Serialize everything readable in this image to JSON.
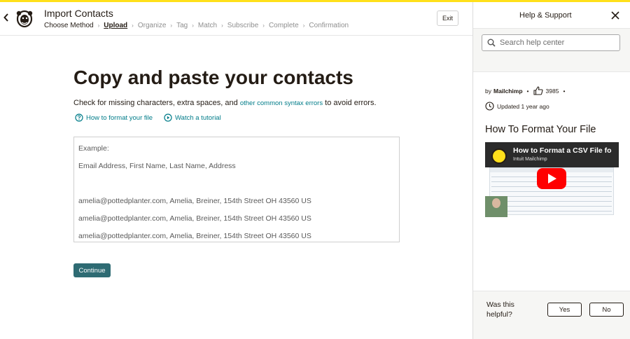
{
  "app": {
    "title": "Import Contacts",
    "exit_label": "Exit",
    "accent_color": "#ffe01b",
    "link_color": "#007c89",
    "button_color": "#2e6b73"
  },
  "steps": [
    {
      "label": "Choose Method",
      "state": "done"
    },
    {
      "label": "Upload",
      "state": "active"
    },
    {
      "label": "Organize",
      "state": "pending"
    },
    {
      "label": "Tag",
      "state": "pending"
    },
    {
      "label": "Match",
      "state": "pending"
    },
    {
      "label": "Subscribe",
      "state": "pending"
    },
    {
      "label": "Complete",
      "state": "pending"
    },
    {
      "label": "Confirmation",
      "state": "pending"
    }
  ],
  "main": {
    "heading": "Copy and paste your contacts",
    "desc_before": "Check for missing characters, extra spaces, and ",
    "desc_link": "other common syntax errors",
    "desc_after": " to avoid errors.",
    "link_format": "How to format your file",
    "link_tutorial": "Watch a tutorial",
    "paste_lines": [
      "Example:",
      "Email Address, First Name, Last Name, Address",
      "amelia@pottedplanter.com, Amelia, Breiner, 154th Street OH 43560 US",
      "amelia@pottedplanter.com, Amelia, Breiner, 154th Street OH 43560 US",
      "amelia@pottedplanter.com, Amelia, Breiner, 154th Street OH 43560 US"
    ],
    "continue_label": "Continue"
  },
  "help": {
    "title": "Help & Support",
    "search_placeholder": "Search help center",
    "by_label": "by",
    "author": "Mailchimp",
    "likes": "3985",
    "updated": "Updated 1 year ago",
    "article_title": "How To Format Your File",
    "video_title": "How to Format a CSV File fo",
    "video_channel": "Intuit Mailchimp",
    "helpful_question": "Was this helpful?",
    "yes_label": "Yes",
    "no_label": "No"
  }
}
